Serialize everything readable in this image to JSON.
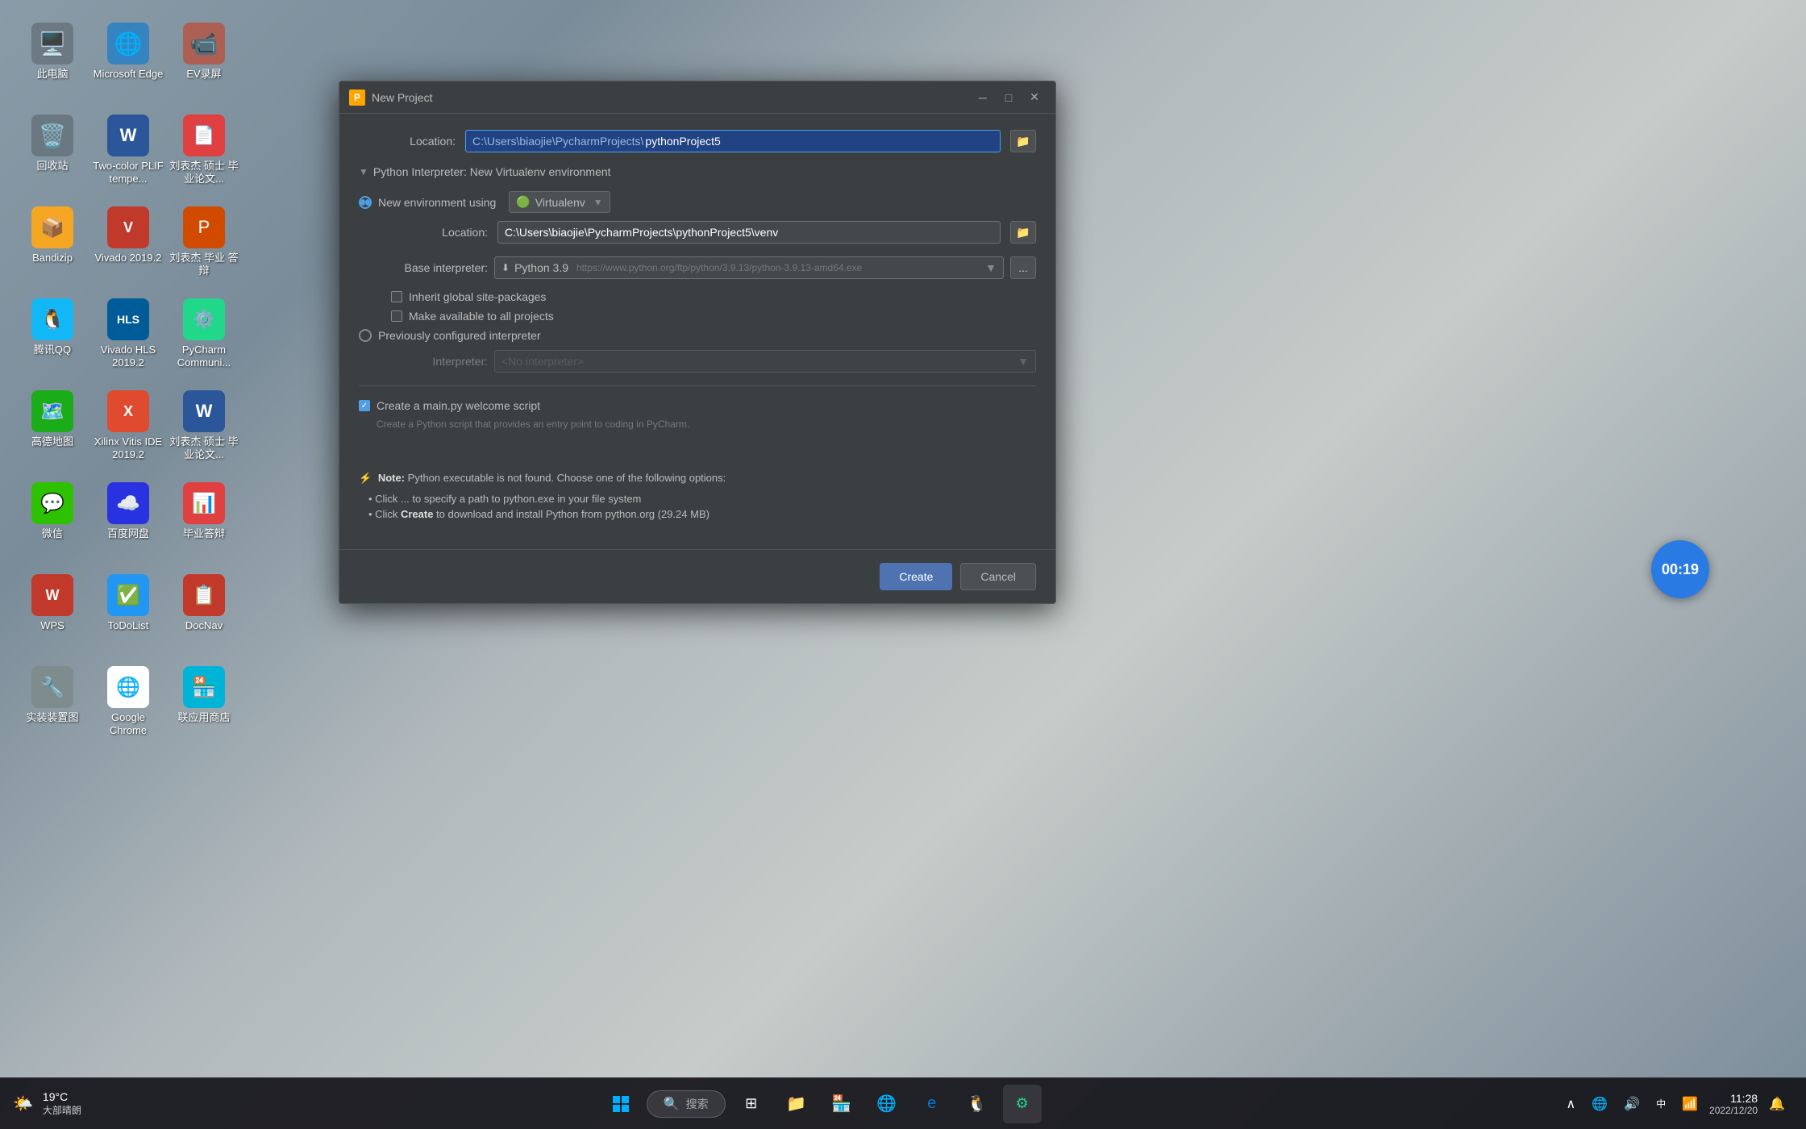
{
  "desktop": {
    "icons": [
      {
        "id": "computer",
        "emoji": "🖥️",
        "label": "此电脑",
        "color": "#3a8fd1"
      },
      {
        "id": "edge",
        "emoji": "🌐",
        "label": "Microsoft Edge",
        "color": "#0078d4"
      },
      {
        "id": "ev",
        "emoji": "📺",
        "label": "EV录屏",
        "color": "#e04a2e"
      },
      {
        "id": "recycle",
        "emoji": "🗑️",
        "label": "回收站",
        "color": "#4a90d9"
      },
      {
        "id": "word",
        "emoji": "W",
        "label": "Two-color PLIF tempe...",
        "color": "#2b579a"
      },
      {
        "id": "pdf",
        "emoji": "📄",
        "label": "刘表杰 硕士 毕业论文...",
        "color": "#e04040"
      },
      {
        "id": "bandizip",
        "emoji": "📦",
        "label": "Bandizip",
        "color": "#f5a623"
      },
      {
        "id": "vivado",
        "emoji": "V",
        "label": "Vivado 2019.2",
        "color": "#e04a2e"
      },
      {
        "id": "ppt",
        "emoji": "P",
        "label": "刘表杰 毕业 答辩",
        "color": "#d04a00"
      },
      {
        "id": "qq",
        "emoji": "🐧",
        "label": "腾讯QQ",
        "color": "#12b7f5"
      },
      {
        "id": "vivado-hls",
        "emoji": "V",
        "label": "Vivado HLS 2019.2",
        "color": "#005c99"
      },
      {
        "id": "pycharm",
        "emoji": "🖥️",
        "label": "PyCharm Communi...",
        "color": "#21d789"
      },
      {
        "id": "amap",
        "emoji": "🗺️",
        "label": "高德地图",
        "color": "#1aad19"
      },
      {
        "id": "xilinx",
        "emoji": "X",
        "label": "Xilinx Vitis IDE 2019.2",
        "color": "#e04a2e"
      },
      {
        "id": "word2",
        "emoji": "W",
        "label": "刘表杰 硕士 毕业论文...",
        "color": "#2b579a"
      },
      {
        "id": "wechat",
        "emoji": "💬",
        "label": "微信",
        "color": "#2dc100"
      },
      {
        "id": "baidu",
        "emoji": "🔵",
        "label": "百度网盘",
        "color": "#2932e1"
      },
      {
        "id": "thesis",
        "emoji": "📊",
        "label": "毕业答辩",
        "color": "#e04040"
      },
      {
        "id": "wps",
        "emoji": "W",
        "label": "WPS",
        "color": "#e04a2e"
      },
      {
        "id": "todo",
        "emoji": "✅",
        "label": "ToDoList",
        "color": "#2196f3"
      },
      {
        "id": "docnav",
        "emoji": "📋",
        "label": "DocNav",
        "color": "#c0392b"
      },
      {
        "id": "tools",
        "emoji": "🔧",
        "label": "实装装置图",
        "color": "#7f8c8d"
      },
      {
        "id": "chrome",
        "emoji": "🌐",
        "label": "Google Chrome",
        "color": "#4285f4"
      },
      {
        "id": "appstore",
        "emoji": "🏪",
        "label": "联应用商店",
        "color": "#00b4d8"
      }
    ]
  },
  "taskbar": {
    "weather": {
      "temp": "19°C",
      "desc": "大部晴朗"
    },
    "search_placeholder": "🔍 搜索",
    "system_tray": {
      "time": "11:28",
      "date": "2022/12/20"
    }
  },
  "dialog": {
    "title": "New Project",
    "location_label": "Location:",
    "location_value_prefix": "C:\\Users\\biaojie\\PycharmProjects\\",
    "location_value_selected": "pythonProject5",
    "location_full": "C:\\Users\\biaojie\\PycharmProjects\\pythonProject5",
    "section_interpreter": "Python Interpreter: New Virtualenv environment",
    "radio_new_env": "New environment using",
    "virtualenv_option": "Virtualenv",
    "location_venv_label": "Location:",
    "location_venv_value": "C:\\Users\\biaojie\\PycharmProjects\\pythonProject5\\venv",
    "base_interp_label": "Base interpreter:",
    "base_interp_value": "Python 3.9",
    "base_interp_url": "https://www.python.org/ftp/python/3.9.13/python-3.9.13-amd64.exe",
    "inherit_label": "Inherit global site-packages",
    "make_available_label": "Make available to all projects",
    "radio_prev_configured": "Previously configured interpreter",
    "interpreter_label": "Interpreter:",
    "interpreter_value": "<No interpreter>",
    "create_script_label": "Create a main.py welcome script",
    "create_script_note": "Create a Python script that provides an entry point to coding in PyCharm.",
    "note_bold": "Note:",
    "note_text": "Python executable is not found. Choose one of the following options:",
    "bullet1": "Click ... to specify a path to python.exe in your file system",
    "bullet2_prefix": "Click ",
    "bullet2_bold": "Create",
    "bullet2_suffix": " to download and install Python from python.org (29.24 MB)",
    "btn_create": "Create",
    "btn_cancel": "Cancel"
  },
  "timer": {
    "display": "00:19"
  }
}
